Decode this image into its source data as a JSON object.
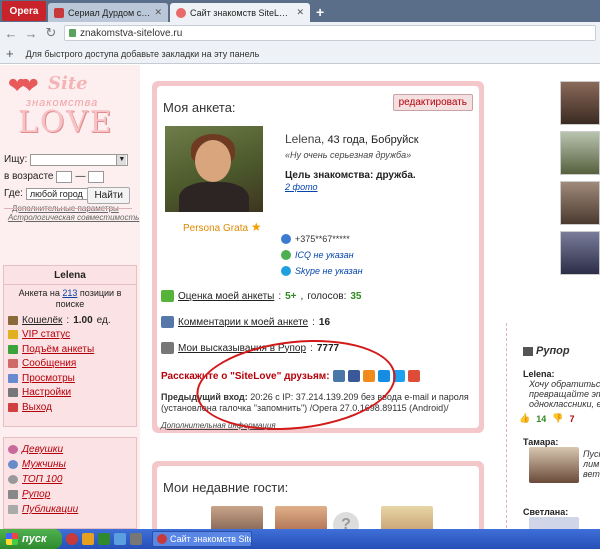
{
  "browser": {
    "menu_label": "Opera",
    "tabs": [
      {
        "title": "Сериал Дурдом смотреть о",
        "active": false
      },
      {
        "title": "Сайт знакомств SiteLove - S",
        "active": true
      }
    ],
    "url": "znakomstva-sitelove.ru",
    "bookmarks_hint": "Для быстрого доступа добавьте закладки на эту панель"
  },
  "logo": {
    "site": "Site",
    "sub": "знакомства",
    "love": "LOVE"
  },
  "search": {
    "find_label": "Ищу:",
    "age_label": "в возрасте",
    "age_sep": "—",
    "where_label": "Где:",
    "where_value": "любой город",
    "advanced": "Дополнительные параметры",
    "button": "Найти",
    "astro": "Астрологическая совместимость"
  },
  "userbox": {
    "name": "Lelena",
    "rank_prefix": "Анкета на",
    "rank_value": "213",
    "rank_suffix": "позиции в поиске",
    "wallet_label": "Кошелёк",
    "wallet_value": "1.00",
    "wallet_unit": "ед.",
    "menu": [
      {
        "label": "VIP статус",
        "color": "#e0b020"
      },
      {
        "label": "Подъём анкеты",
        "color": "#3aa33a"
      },
      {
        "label": "Сообщения",
        "color": "#d06a6a"
      },
      {
        "label": "Просмотры",
        "color": "#6a8ad0"
      },
      {
        "label": "Настройки",
        "color": "#777777"
      },
      {
        "label": "Выход",
        "color": "#d04040"
      }
    ]
  },
  "nav": {
    "items": [
      "Девушки",
      "Мужчины",
      "ТОП 100",
      "Рупор",
      "Публикации"
    ]
  },
  "profile": {
    "title": "Моя анкета:",
    "edit": "редактировать",
    "name": "Lelena,",
    "info": "43 года, Бобруйск",
    "quote": "«Ну очень серьезная дружба»",
    "goal": "Цель знакомства: дружба.",
    "photos": "2 фото",
    "badge": "Persona Grata",
    "phone": "+375**67*****",
    "icq": "ICQ не указан",
    "skype": "Skype не указан",
    "rating_label": "Оценка моей анкеты",
    "rating_value": "5+",
    "rating_votes_label": "голосов:",
    "rating_votes": "35",
    "comments_label": "Комментарии к моей анкете",
    "comments_value": "16",
    "rupor_label": "Мои высказывания в Рупор",
    "rupor_value": "7777",
    "tell": "Расскажите о \"SiteLove\" друзьям:",
    "last_login_label": "Предыдущий вход:",
    "last_login_text": "20:26 с IP: 37.214.139.209 без ввода e-mail и пароля (установлена галочка \"запомнить\") /Opera 27.0.1698.89115 (Android)/",
    "more_info": "Дополнительная информация"
  },
  "guests": {
    "title": "Мои недавние гости:"
  },
  "rupor": {
    "title": "Рупор",
    "posts": [
      {
        "user": "Lelena:",
        "lines": [
          "Хочу обратиться",
          "превращайте это",
          "одноклассники, еко"
        ],
        "up": "14",
        "down": "7"
      },
      {
        "user": "Тамара:",
        "lines": [
          "Пуст",
          "лим",
          "вет"
        ],
        "up": "",
        "down": ""
      },
      {
        "user": "Светлана:",
        "lines": [],
        "up": "",
        "down": ""
      }
    ]
  },
  "taskbar": {
    "start": "пуск",
    "task": "Сайт знакомств SiteL..."
  },
  "colors": {
    "accent": "#b5000a",
    "card": "#f4c8ca",
    "sidebar": "#fdeff0"
  }
}
